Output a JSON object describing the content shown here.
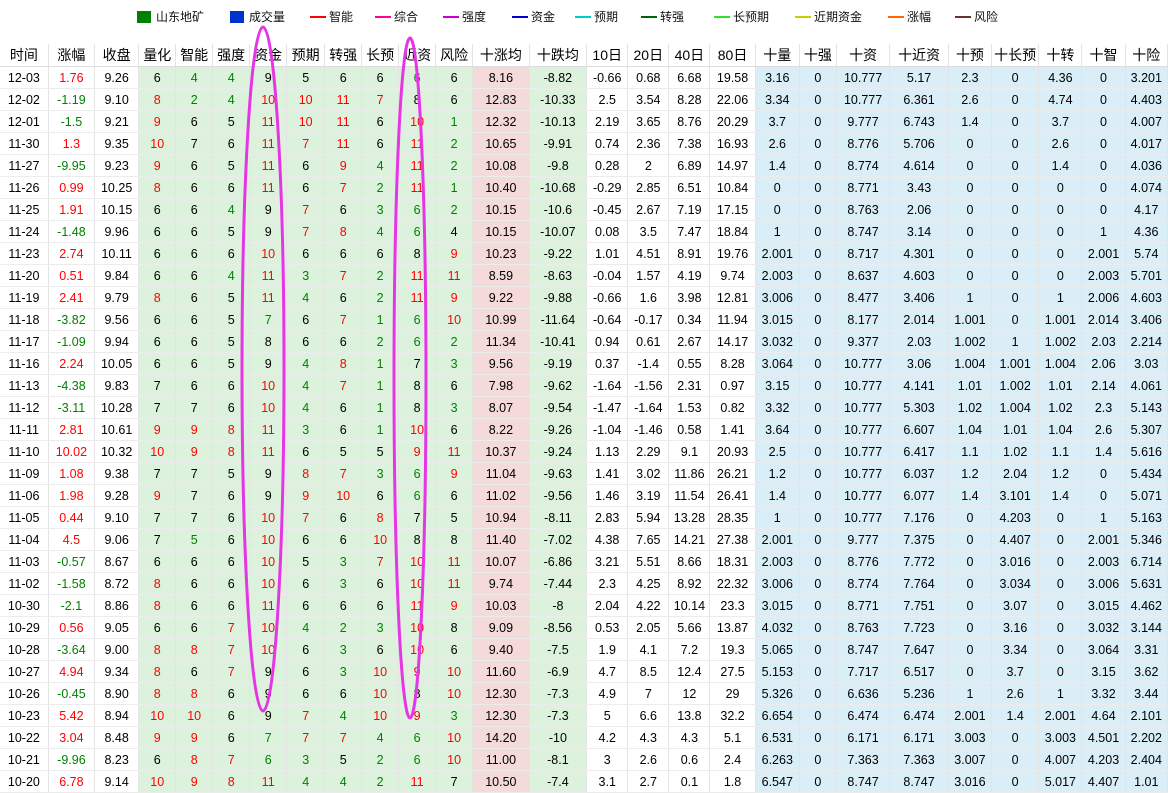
{
  "legend": [
    {
      "label": "山东地矿",
      "color": "#008000",
      "kind": "box"
    },
    {
      "label": "成交量",
      "color": "#0033cc",
      "kind": "box"
    },
    {
      "label": "智能",
      "color": "#ff0000",
      "kind": "line"
    },
    {
      "label": "综合",
      "color": "#ff0099",
      "kind": "line"
    },
    {
      "label": "强度",
      "color": "#cc00cc",
      "kind": "line"
    },
    {
      "label": "资金",
      "color": "#0000cc",
      "kind": "line"
    },
    {
      "label": "预期",
      "color": "#00cccc",
      "kind": "line"
    },
    {
      "label": "转强",
      "color": "#006600",
      "kind": "line"
    },
    {
      "label": "长预期",
      "color": "#33dd33",
      "kind": "line"
    },
    {
      "label": "近期资金",
      "color": "#cccc00",
      "kind": "line"
    },
    {
      "label": "涨幅",
      "color": "#ff6600",
      "kind": "line"
    },
    {
      "label": "风险",
      "color": "#663333",
      "kind": "line"
    }
  ],
  "table": {
    "headers": [
      "时间",
      "涨幅",
      "收盘",
      "量化",
      "智能",
      "强度",
      "资金",
      "预期",
      "转强",
      "长预",
      "近资",
      "风险",
      "十涨均",
      "十跌均",
      "10日",
      "20日",
      "40日",
      "80日",
      "十量",
      "十强",
      "十资",
      "十近资",
      "十预",
      "十长预",
      "十转",
      "十智",
      "十险"
    ],
    "rows": [
      [
        "12-03",
        "1.76",
        "9.26",
        "6",
        "4",
        "4",
        "9",
        "5",
        "6",
        "6",
        "6",
        "6",
        "8.16",
        "-8.82",
        "-0.66",
        "0.68",
        "6.68",
        "19.58",
        "3.16",
        "0",
        "10.777",
        "5.17",
        "2.3",
        "0",
        "4.36",
        "0",
        "3.201"
      ],
      [
        "12-02",
        "-1.19",
        "9.10",
        "8",
        "2",
        "4",
        "10",
        "10",
        "11",
        "7",
        "8",
        "6",
        "12.83",
        "-10.33",
        "2.5",
        "3.54",
        "8.28",
        "22.06",
        "3.34",
        "0",
        "10.777",
        "6.361",
        "2.6",
        "0",
        "4.74",
        "0",
        "4.403"
      ],
      [
        "12-01",
        "-1.5",
        "9.21",
        "9",
        "6",
        "5",
        "11",
        "10",
        "11",
        "6",
        "10",
        "1",
        "12.32",
        "-10.13",
        "2.19",
        "3.65",
        "8.76",
        "20.29",
        "3.7",
        "0",
        "9.777",
        "6.743",
        "1.4",
        "0",
        "3.7",
        "0",
        "4.007"
      ],
      [
        "11-30",
        "1.3",
        "9.35",
        "10",
        "7",
        "6",
        "11",
        "7",
        "11",
        "6",
        "11",
        "2",
        "10.65",
        "-9.91",
        "0.74",
        "2.36",
        "7.38",
        "16.93",
        "2.6",
        "0",
        "8.776",
        "5.706",
        "0",
        "0",
        "2.6",
        "0",
        "4.017"
      ],
      [
        "11-27",
        "-9.95",
        "9.23",
        "9",
        "6",
        "5",
        "11",
        "6",
        "9",
        "4",
        "11",
        "2",
        "10.08",
        "-9.8",
        "0.28",
        "2",
        "6.89",
        "14.97",
        "1.4",
        "0",
        "8.774",
        "4.614",
        "0",
        "0",
        "1.4",
        "0",
        "4.036"
      ],
      [
        "11-26",
        "0.99",
        "10.25",
        "8",
        "6",
        "6",
        "11",
        "6",
        "7",
        "2",
        "11",
        "1",
        "10.40",
        "-10.68",
        "-0.29",
        "2.85",
        "6.51",
        "10.84",
        "0",
        "0",
        "8.771",
        "3.43",
        "0",
        "0",
        "0",
        "0",
        "4.074"
      ],
      [
        "11-25",
        "1.91",
        "10.15",
        "6",
        "6",
        "4",
        "9",
        "7",
        "6",
        "3",
        "6",
        "2",
        "10.15",
        "-10.6",
        "-0.45",
        "2.67",
        "7.19",
        "17.15",
        "0",
        "0",
        "8.763",
        "2.06",
        "0",
        "0",
        "0",
        "0",
        "4.17"
      ],
      [
        "11-24",
        "-1.48",
        "9.96",
        "6",
        "6",
        "5",
        "9",
        "7",
        "8",
        "4",
        "6",
        "4",
        "10.15",
        "-10.07",
        "0.08",
        "3.5",
        "7.47",
        "18.84",
        "1",
        "0",
        "8.747",
        "3.14",
        "0",
        "0",
        "0",
        "1",
        "4.36"
      ],
      [
        "11-23",
        "2.74",
        "10.11",
        "6",
        "6",
        "6",
        "10",
        "6",
        "6",
        "6",
        "8",
        "9",
        "10.23",
        "-9.22",
        "1.01",
        "4.51",
        "8.91",
        "19.76",
        "2.001",
        "0",
        "8.717",
        "4.301",
        "0",
        "0",
        "0",
        "2.001",
        "5.74"
      ],
      [
        "11-20",
        "0.51",
        "9.84",
        "6",
        "6",
        "4",
        "11",
        "3",
        "7",
        "2",
        "11",
        "11",
        "8.59",
        "-8.63",
        "-0.04",
        "1.57",
        "4.19",
        "9.74",
        "2.003",
        "0",
        "8.637",
        "4.603",
        "0",
        "0",
        "0",
        "2.003",
        "5.701"
      ],
      [
        "11-19",
        "2.41",
        "9.79",
        "8",
        "6",
        "5",
        "11",
        "4",
        "6",
        "2",
        "11",
        "9",
        "9.22",
        "-9.88",
        "-0.66",
        "1.6",
        "3.98",
        "12.81",
        "3.006",
        "0",
        "8.477",
        "3.406",
        "1",
        "0",
        "1",
        "2.006",
        "4.603"
      ],
      [
        "11-18",
        "-3.82",
        "9.56",
        "6",
        "6",
        "5",
        "7",
        "6",
        "7",
        "1",
        "6",
        "10",
        "10.99",
        "-11.64",
        "-0.64",
        "-0.17",
        "0.34",
        "11.94",
        "3.015",
        "0",
        "8.177",
        "2.014",
        "1.001",
        "0",
        "1.001",
        "2.014",
        "3.406"
      ],
      [
        "11-17",
        "-1.09",
        "9.94",
        "6",
        "6",
        "5",
        "8",
        "6",
        "6",
        "2",
        "6",
        "2",
        "11.34",
        "-10.41",
        "0.94",
        "0.61",
        "2.67",
        "14.17",
        "3.032",
        "0",
        "9.377",
        "2.03",
        "1.002",
        "1",
        "1.002",
        "2.03",
        "2.214"
      ],
      [
        "11-16",
        "2.24",
        "10.05",
        "6",
        "6",
        "5",
        "9",
        "4",
        "8",
        "1",
        "7",
        "3",
        "9.56",
        "-9.19",
        "0.37",
        "-1.4",
        "0.55",
        "8.28",
        "3.064",
        "0",
        "10.777",
        "3.06",
        "1.004",
        "1.001",
        "1.004",
        "2.06",
        "3.03"
      ],
      [
        "11-13",
        "-4.38",
        "9.83",
        "7",
        "6",
        "6",
        "10",
        "4",
        "7",
        "1",
        "8",
        "6",
        "7.98",
        "-9.62",
        "-1.64",
        "-1.56",
        "2.31",
        "0.97",
        "3.15",
        "0",
        "10.777",
        "4.141",
        "1.01",
        "1.002",
        "1.01",
        "2.14",
        "4.061"
      ],
      [
        "11-12",
        "-3.11",
        "10.28",
        "7",
        "7",
        "6",
        "10",
        "4",
        "6",
        "1",
        "8",
        "3",
        "8.07",
        "-9.54",
        "-1.47",
        "-1.64",
        "1.53",
        "0.82",
        "3.32",
        "0",
        "10.777",
        "5.303",
        "1.02",
        "1.004",
        "1.02",
        "2.3",
        "5.143"
      ],
      [
        "11-11",
        "2.81",
        "10.61",
        "9",
        "9",
        "8",
        "11",
        "3",
        "6",
        "1",
        "10",
        "6",
        "8.22",
        "-9.26",
        "-1.04",
        "-1.46",
        "0.58",
        "1.41",
        "3.64",
        "0",
        "10.777",
        "6.607",
        "1.04",
        "1.01",
        "1.04",
        "2.6",
        "5.307"
      ],
      [
        "11-10",
        "10.02",
        "10.32",
        "10",
        "9",
        "8",
        "11",
        "6",
        "5",
        "5",
        "9",
        "11",
        "10.37",
        "-9.24",
        "1.13",
        "2.29",
        "9.1",
        "20.93",
        "2.5",
        "0",
        "10.777",
        "6.417",
        "1.1",
        "1.02",
        "1.1",
        "1.4",
        "5.616"
      ],
      [
        "11-09",
        "1.08",
        "9.38",
        "7",
        "7",
        "5",
        "9",
        "8",
        "7",
        "3",
        "6",
        "9",
        "11.04",
        "-9.63",
        "1.41",
        "3.02",
        "11.86",
        "26.21",
        "1.2",
        "0",
        "10.777",
        "6.037",
        "1.2",
        "2.04",
        "1.2",
        "0",
        "5.434"
      ],
      [
        "11-06",
        "1.98",
        "9.28",
        "9",
        "7",
        "6",
        "9",
        "9",
        "10",
        "6",
        "6",
        "6",
        "11.02",
        "-9.56",
        "1.46",
        "3.19",
        "11.54",
        "26.41",
        "1.4",
        "0",
        "10.777",
        "6.077",
        "1.4",
        "3.101",
        "1.4",
        "0",
        "5.071"
      ],
      [
        "11-05",
        "0.44",
        "9.10",
        "7",
        "7",
        "6",
        "10",
        "7",
        "6",
        "8",
        "7",
        "5",
        "10.94",
        "-8.11",
        "2.83",
        "5.94",
        "13.28",
        "28.35",
        "1",
        "0",
        "10.777",
        "7.176",
        "0",
        "4.203",
        "0",
        "1",
        "5.163"
      ],
      [
        "11-04",
        "4.5",
        "9.06",
        "7",
        "5",
        "6",
        "10",
        "6",
        "6",
        "10",
        "8",
        "8",
        "11.40",
        "-7.02",
        "4.38",
        "7.65",
        "14.21",
        "27.38",
        "2.001",
        "0",
        "9.777",
        "7.375",
        "0",
        "4.407",
        "0",
        "2.001",
        "5.346"
      ],
      [
        "11-03",
        "-0.57",
        "8.67",
        "6",
        "6",
        "6",
        "10",
        "5",
        "3",
        "7",
        "10",
        "11",
        "10.07",
        "-6.86",
        "3.21",
        "5.51",
        "8.66",
        "18.31",
        "2.003",
        "0",
        "8.776",
        "7.772",
        "0",
        "3.016",
        "0",
        "2.003",
        "6.714"
      ],
      [
        "11-02",
        "-1.58",
        "8.72",
        "8",
        "6",
        "6",
        "10",
        "6",
        "3",
        "6",
        "10",
        "11",
        "9.74",
        "-7.44",
        "2.3",
        "4.25",
        "8.92",
        "22.32",
        "3.006",
        "0",
        "8.774",
        "7.764",
        "0",
        "3.034",
        "0",
        "3.006",
        "5.631"
      ],
      [
        "10-30",
        "-2.1",
        "8.86",
        "8",
        "6",
        "6",
        "11",
        "6",
        "6",
        "6",
        "11",
        "9",
        "10.03",
        "-8",
        "2.04",
        "4.22",
        "10.14",
        "23.3",
        "3.015",
        "0",
        "8.771",
        "7.751",
        "0",
        "3.07",
        "0",
        "3.015",
        "4.462"
      ],
      [
        "10-29",
        "0.56",
        "9.05",
        "6",
        "6",
        "7",
        "10",
        "4",
        "2",
        "3",
        "10",
        "8",
        "9.09",
        "-8.56",
        "0.53",
        "2.05",
        "5.66",
        "13.87",
        "4.032",
        "0",
        "8.763",
        "7.723",
        "0",
        "3.16",
        "0",
        "3.032",
        "3.144"
      ],
      [
        "10-28",
        "-3.64",
        "9.00",
        "8",
        "8",
        "7",
        "10",
        "6",
        "3",
        "6",
        "10",
        "6",
        "9.40",
        "-7.5",
        "1.9",
        "4.1",
        "7.2",
        "19.3",
        "5.065",
        "0",
        "8.747",
        "7.647",
        "0",
        "3.34",
        "0",
        "3.064",
        "3.31"
      ],
      [
        "10-27",
        "4.94",
        "9.34",
        "8",
        "6",
        "7",
        "9",
        "6",
        "3",
        "10",
        "9",
        "10",
        "11.60",
        "-6.9",
        "4.7",
        "8.5",
        "12.4",
        "27.5",
        "5.153",
        "0",
        "7.717",
        "6.517",
        "0",
        "3.7",
        "0",
        "3.15",
        "3.62"
      ],
      [
        "10-26",
        "-0.45",
        "8.90",
        "8",
        "8",
        "6",
        "9",
        "6",
        "6",
        "10",
        "8",
        "10",
        "12.30",
        "-7.3",
        "4.9",
        "7",
        "12",
        "29",
        "5.326",
        "0",
        "6.636",
        "5.236",
        "1",
        "2.6",
        "1",
        "3.32",
        "3.44"
      ],
      [
        "10-23",
        "5.42",
        "8.94",
        "10",
        "10",
        "6",
        "9",
        "7",
        "4",
        "10",
        "9",
        "3",
        "12.30",
        "-7.3",
        "5",
        "6.6",
        "13.8",
        "32.2",
        "6.654",
        "0",
        "6.474",
        "6.474",
        "2.001",
        "1.4",
        "2.001",
        "4.64",
        "2.101"
      ],
      [
        "10-22",
        "3.04",
        "8.48",
        "9",
        "9",
        "6",
        "7",
        "7",
        "7",
        "4",
        "6",
        "10",
        "14.20",
        "-10",
        "4.2",
        "4.3",
        "4.3",
        "5.1",
        "6.531",
        "0",
        "6.171",
        "6.171",
        "3.003",
        "0",
        "3.003",
        "4.501",
        "2.202"
      ],
      [
        "10-21",
        "-9.96",
        "8.23",
        "6",
        "8",
        "7",
        "6",
        "3",
        "5",
        "2",
        "6",
        "10",
        "11.00",
        "-8.1",
        "3",
        "2.6",
        "0.6",
        "2.4",
        "6.263",
        "0",
        "7.363",
        "7.363",
        "3.007",
        "0",
        "4.007",
        "4.203",
        "2.404"
      ],
      [
        "10-20",
        "6.78",
        "9.14",
        "10",
        "9",
        "8",
        "11",
        "4",
        "4",
        "2",
        "11",
        "7",
        "10.50",
        "-7.4",
        "3.1",
        "2.7",
        "0.1",
        "1.8",
        "6.547",
        "0",
        "8.747",
        "8.747",
        "3.016",
        "0",
        "5.017",
        "4.407",
        "1.01"
      ]
    ]
  },
  "colors": {
    "up": "#ff0000",
    "down": "#008000",
    "neutral": "#000000",
    "pink_col": "#f5dada",
    "green_col": "#ddf2dd",
    "blue_col": "#d9eef6",
    "oval": "#e535e5"
  }
}
